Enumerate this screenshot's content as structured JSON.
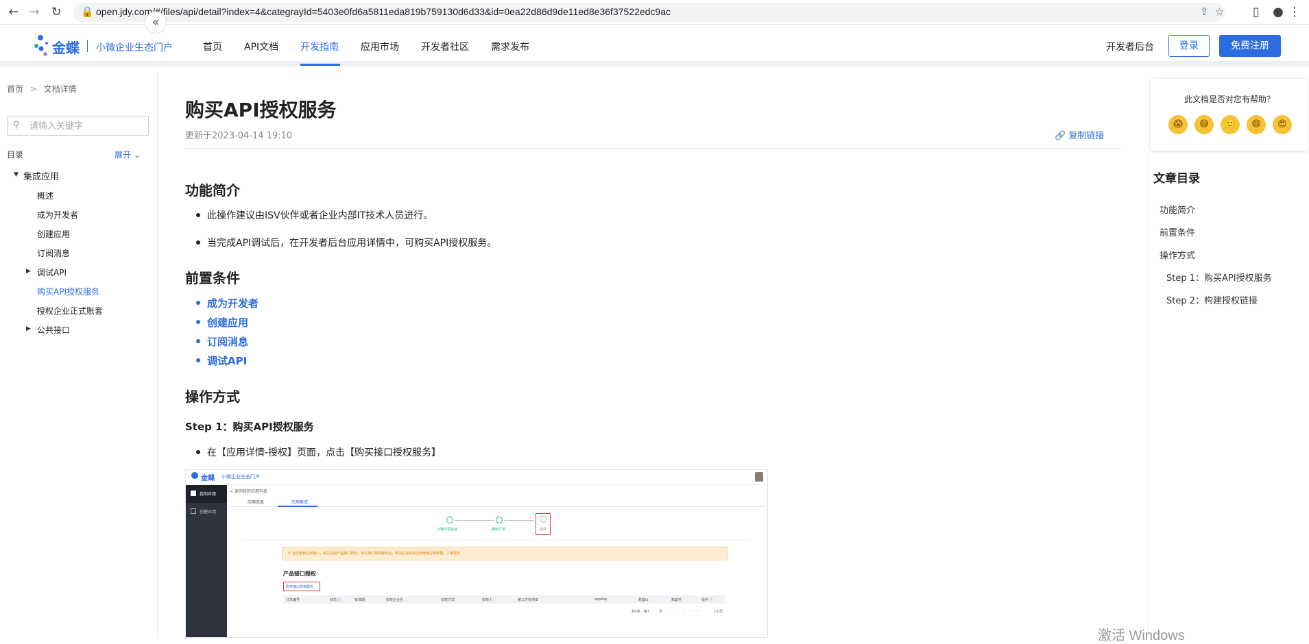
{
  "browser": {
    "url": "open.jdy.com/#/files/api/detail?index=4&categrayId=5403e0fd6a5811eda819b759130d6d33&id=0ea22d86d9de11ed8e36f37522edc9ac"
  },
  "header": {
    "logo_text": "金蝶",
    "logo_sub": "小微企业生态门户",
    "nav": [
      "首页",
      "API文档",
      "开发指南",
      "应用市场",
      "开发者社区",
      "需求发布"
    ],
    "active_nav": "开发指南",
    "dev_console": "开发者后台",
    "login": "登录",
    "signup": "免费注册"
  },
  "sidebar": {
    "breadcrumb_home": "首页",
    "breadcrumb_sep": ">",
    "breadcrumb_current": "文档详情",
    "search_placeholder": "请输入关键字",
    "toc_label": "目录",
    "expand": "展开",
    "tree": [
      {
        "label": "集成应用",
        "level": 0,
        "arrow": "down"
      },
      {
        "label": "概述",
        "level": 1
      },
      {
        "label": "成为开发者",
        "level": 1
      },
      {
        "label": "创建应用",
        "level": 1
      },
      {
        "label": "订阅消息",
        "level": 1
      },
      {
        "label": "调试API",
        "level": 1,
        "arrow": "right"
      },
      {
        "label": "购买API授权服务",
        "level": 1,
        "active": true
      },
      {
        "label": "授权企业正式账套",
        "level": 1
      },
      {
        "label": "公共接口",
        "level": 1,
        "arrow": "right"
      }
    ]
  },
  "article": {
    "title": "购买API授权服务",
    "updated": "更新于2023-04-14 19:10",
    "copy_link": "复制链接",
    "sec1_title": "功能简介",
    "sec1_items": [
      "此操作建议由ISV伙伴或者企业内部IT技术人员进行。",
      "当完成API调试后，在开发者后台应用详情中，可购买API授权服务。"
    ],
    "sec2_title": "前置条件",
    "sec2_links": [
      "成为开发者",
      "创建应用",
      "订阅消息",
      "调试API"
    ],
    "sec3_title": "操作方式",
    "step1_title": "Step 1：购买API授权服务",
    "step1_items": [
      "在【应用详情-授权】页面，点击【购买接口授权服务】"
    ]
  },
  "screenshot": {
    "logo_text": "金蝶",
    "logo_sub": "小微企业生态门户",
    "back": "< 返回我的应用列表",
    "side_items": [
      "我的应用",
      "创建应用"
    ],
    "tabs": [
      "应用信息",
      "应用集成"
    ],
    "steps": [
      "沙箱环境验证",
      "接收订阅",
      "授权"
    ],
    "notice": "① 当前账套应用接入，需先完成产品接口授权，购买接口授权服务后，再由企业授权应用使用应用数据。了解更多",
    "section_title": "产品接口授权",
    "buy_button": "购买接口授权服务",
    "table_headers": [
      "订单编号",
      "状态 ⓘ",
      "有效期",
      "授权企业名",
      "授权方式",
      "授权人",
      "第三方实例ID",
      "appKey",
      "账套id",
      "账套名",
      "操作 ⓘ"
    ],
    "pager": [
      "共0条",
      "第1",
      "页",
      "10/页"
    ]
  },
  "feedback": {
    "question": "此文档是否对您有帮助？",
    "emojis": [
      "😱",
      "😅",
      "🙂",
      "😄",
      "😍"
    ]
  },
  "article_toc": {
    "title": "文章目录",
    "items": [
      {
        "label": "功能简介",
        "level": 0
      },
      {
        "label": "前置条件",
        "level": 0
      },
      {
        "label": "操作方式",
        "level": 0
      },
      {
        "label": "Step 1：购买API授权服务",
        "level": 1
      },
      {
        "label": "Step 2：构建授权链接",
        "level": 1
      }
    ]
  },
  "watermark": "激活 Windows",
  "colors": {
    "brand": "#2b6dde",
    "warning_bg": "#fdeed3",
    "dark_side": "#2f3340",
    "danger": "#e4393c",
    "success": "#22b573"
  }
}
